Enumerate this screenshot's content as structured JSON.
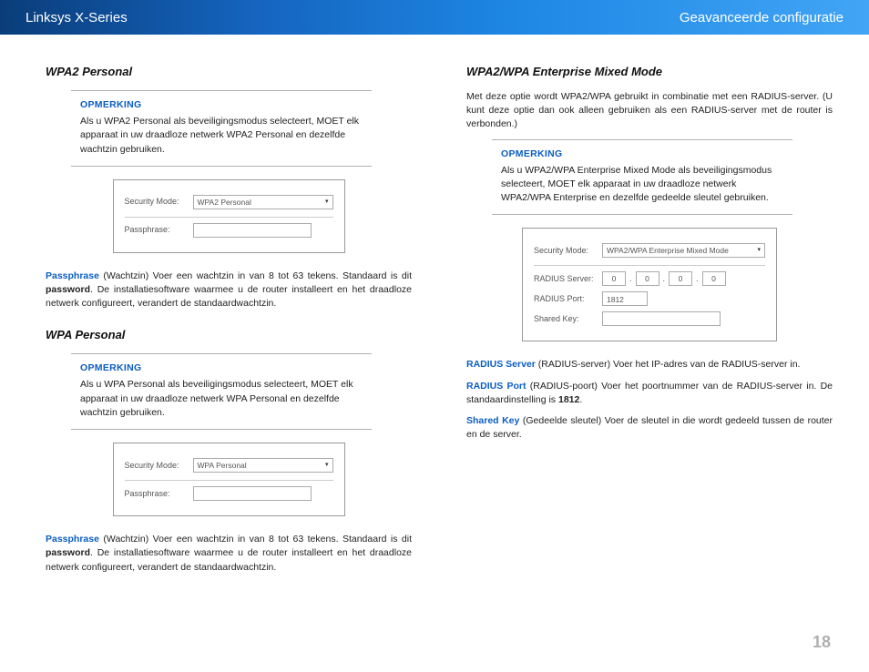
{
  "header": {
    "left": "Linksys X-Series",
    "right": "Geavanceerde configuratie"
  },
  "left": {
    "section1": {
      "title": "WPA2 Personal",
      "note_heading": "OPMERKING",
      "note_body": "Als u WPA2 Personal als beveiligingsmodus selecteert, MOET elk apparaat in uw draadloze netwerk WPA2 Personal en dezelfde wachtzin gebruiken.",
      "fig": {
        "label_security": "Security Mode:",
        "value_security": "WPA2 Personal",
        "label_pass": "Passphrase:"
      },
      "para_term": "Passphrase",
      "para_body": " (Wachtzin) Voer een wachtzin in van 8 tot 63 tekens. Standaard is dit ",
      "para_bold": "password",
      "para_tail": ". De installatiesoftware waarmee u de router installeert en het draadloze netwerk configureert, verandert de standaardwachtzin."
    },
    "section2": {
      "title": "WPA Personal",
      "note_heading": "OPMERKING",
      "note_body": "Als u WPA Personal als beveiligingsmodus selecteert, MOET elk apparaat in uw draadloze netwerk WPA Personal en dezelfde wachtzin gebruiken.",
      "fig": {
        "label_security": "Security Mode:",
        "value_security": "WPA Personal",
        "label_pass": "Passphrase:"
      },
      "para_term": "Passphrase",
      "para_body": " (Wachtzin) Voer een wachtzin in van 8 tot 63 tekens. Standaard is dit ",
      "para_bold": "password",
      "para_tail": ". De installatiesoftware waarmee u de router installeert en het draadloze netwerk configureert, verandert de standaardwachtzin."
    }
  },
  "right": {
    "section1": {
      "title": "WPA2/WPA Enterprise Mixed Mode",
      "intro": "Met deze optie wordt WPA2/WPA gebruikt in combinatie met een RADIUS-server. (U kunt deze optie dan ook alleen gebruiken als een RADIUS-server met de router is verbonden.)",
      "note_heading": "OPMERKING",
      "note_body": "Als u WPA2/WPA Enterprise Mixed Mode als beveiligingsmodus selecteert, MOET elk apparaat in uw draadloze netwerk WPA2/WPA Enterprise en dezelfde gedeelde sleutel gebruiken.",
      "fig": {
        "label_security": "Security Mode:",
        "value_security": "WPA2/WPA Enterprise Mixed Mode",
        "label_radius_server": "RADIUS Server:",
        "ip": [
          "0",
          "0",
          "0",
          "0"
        ],
        "label_radius_port": "RADIUS Port:",
        "value_radius_port": "1812",
        "label_shared_key": "Shared Key:"
      },
      "para1_term": "RADIUS Server",
      "para1_body": " (RADIUS-server) Voer het IP-adres van de RADIUS-server in.",
      "para2_term": "RADIUS Port",
      "para2_body": " (RADIUS-poort) Voer het poortnummer van de RADIUS-server in. De standaardinstelling is ",
      "para2_bold": "1812",
      "para2_tail": ".",
      "para3_term": "Shared Key",
      "para3_body": " (Gedeelde sleutel) Voer de sleutel in die wordt gedeeld tussen de router en de server."
    }
  },
  "page_number": "18"
}
